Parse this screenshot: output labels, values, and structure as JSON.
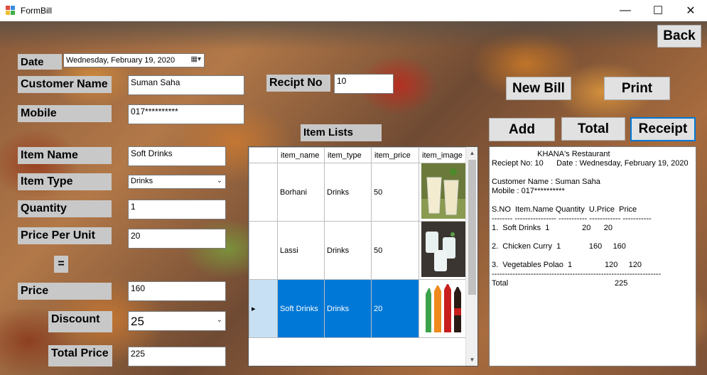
{
  "window": {
    "title": "FormBill"
  },
  "form": {
    "date_label": "Date",
    "date_value": "Wednesday,   February   19, 2020",
    "customer_name_label": "Customer Name",
    "customer_name_value": "Suman Saha",
    "mobile_label": "Mobile",
    "mobile_value": "017**********",
    "receipt_no_label": "Recipt No",
    "receipt_no_value": "10",
    "item_name_label": "Item Name",
    "item_name_value": "Soft Drinks",
    "item_type_label": "Item Type",
    "item_type_value": "Drinks",
    "quantity_label": "Quantity",
    "quantity_value": "1",
    "price_per_unit_label": "Price Per Unit",
    "price_per_unit_value": "20",
    "equals_label": "=",
    "price_label": "Price",
    "price_value": "160",
    "discount_label": "Discount",
    "discount_value": "25",
    "total_price_label": "Total Price",
    "total_price_value": "225",
    "item_lists_label": "Item Lists"
  },
  "buttons": {
    "back": "Back",
    "new_bill": "New Bill",
    "print": "Print",
    "add": "Add",
    "total": "Total",
    "receipt": "Receipt"
  },
  "grid": {
    "columns": [
      "item_name",
      "item_type",
      "item_price",
      "item_image"
    ],
    "rows": [
      {
        "item_name": "Borhani",
        "item_type": "Drinks",
        "item_price": "50",
        "image": "borhani-glasses"
      },
      {
        "item_name": "Lassi",
        "item_type": "Drinks",
        "item_price": "50",
        "image": "lassi-glasses"
      },
      {
        "item_name": "Soft Drinks",
        "item_type": "Drinks",
        "item_price": "20",
        "image": "soda-bottles",
        "selected": true
      }
    ]
  },
  "receipt": {
    "text": "                     KHANA's Restaurant\nReciept No: 10      Date : Wednesday, February 19, 2020\n\nCustomer Name : Suman Saha\nMobile : 017**********\n\nS.NO  Item.Name Quantity  U.Price  Price\n-------- ---------------- ----------- ------------ -----------\n1.  Soft Drinks  1               20      20\n\n2.  Chicken Curry  1             160     160\n\n3.  Vegetables Polao  1               120     120\n-----------------------------------------------------------------\nTotal                                                 225"
  },
  "colors": {
    "label_bg": "#c8c8c8",
    "selection": "#0078d7",
    "focus_border": "#0078d7"
  }
}
